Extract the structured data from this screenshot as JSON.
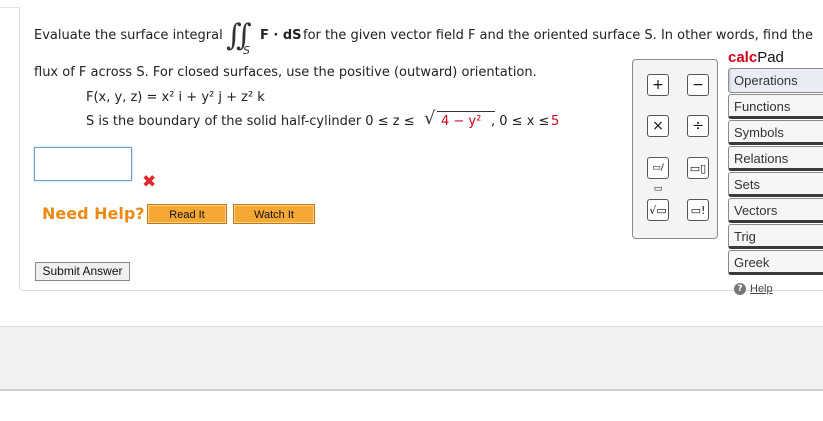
{
  "question": {
    "line1_prefix": "Evaluate the surface integral",
    "integral_symbol": "∬",
    "integral_subscript": "S",
    "integrand": "F · dS",
    "line1_suffix": "for the given vector field F and the oriented surface S. In other words, find the",
    "line2": "flux of F across S. For closed surfaces, use the positive (outward) orientation.",
    "field_eq": "F(x, y, z) = x² i + y² j + z² k",
    "surface_prefix": "S is the boundary of the solid half-cylinder 0 ≤ z ≤",
    "surface_sqrt": "4 − y²",
    "surface_suffix": ", 0 ≤ x ≤",
    "surface_x_max": "5"
  },
  "answer": {
    "value": "",
    "status_icon": "x-mark-icon"
  },
  "help": {
    "label": "Need Help?",
    "read_it": "Read It",
    "watch_it": "Watch It"
  },
  "submit_label": "Submit Answer",
  "calcpad": {
    "title_calc": "calc",
    "title_pad": "Pad",
    "keys": [
      "+",
      "−",
      "×",
      "÷",
      "▭/▭",
      "▭▯",
      "√▭",
      "▭!"
    ],
    "tabs": [
      "Operations",
      "Functions",
      "Symbols",
      "Relations",
      "Sets",
      "Vectors",
      "Trig",
      "Greek"
    ],
    "help_link": "Help"
  },
  "colors": {
    "accent_orange": "#ee8a14",
    "error_red": "#e0282c",
    "calc_red": "#d0021b"
  }
}
